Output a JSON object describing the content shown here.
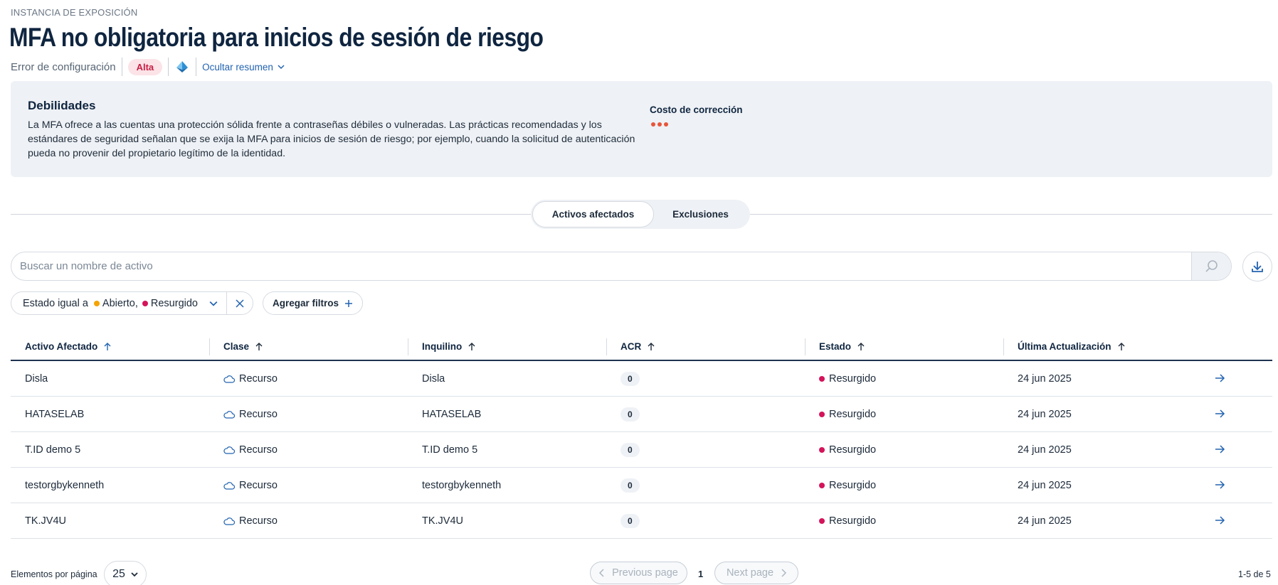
{
  "header": {
    "eyebrow": "INSTANCIA DE EXPOSICIÓN",
    "title": "MFA no obligatoria para inicios de sesión de riesgo",
    "category": "Error de configuración",
    "severity": "Alta",
    "platform_icon": "azure-icon",
    "summary_toggle": "Ocultar resumen"
  },
  "weakness": {
    "title": "Debilidades",
    "text": "La MFA ofrece a las cuentas una protección sólida frente a contraseñas débiles o vulneradas. Las prácticas recomendadas y los estándares de seguridad señalan que se exija la MFA para inicios de sesión de riesgo; por ejemplo, cuando la solicitud de autenticación pueda no provenir del propietario legítimo de la identidad.",
    "cost_label": "Costo de corrección",
    "cost_dots": 3
  },
  "tabs": [
    {
      "label": "Activos afectados",
      "active": true
    },
    {
      "label": "Exclusiones",
      "active": false
    }
  ],
  "search": {
    "placeholder": "Buscar un nombre de activo",
    "value": ""
  },
  "filter": {
    "prefix": "Estado igual a",
    "values": [
      {
        "label": "Abierto,",
        "color": "#f5a300"
      },
      {
        "label": "Resurgido",
        "color": "#d4145a"
      }
    ],
    "add_label": "Agregar filtros"
  },
  "table": {
    "columns": [
      "Activo Afectado",
      "Clase",
      "Inquilino",
      "ACR",
      "Estado",
      "Última Actualización"
    ],
    "rows": [
      {
        "asset": "Disla",
        "class": "Recurso",
        "tenant": "Disla",
        "acr": "0",
        "status": "Resurgido",
        "updated": "24 jun 2025"
      },
      {
        "asset": "HATASELAB",
        "class": "Recurso",
        "tenant": "HATASELAB",
        "acr": "0",
        "status": "Resurgido",
        "updated": "24 jun 2025"
      },
      {
        "asset": "T.ID demo 5",
        "class": "Recurso",
        "tenant": "T.ID demo 5",
        "acr": "0",
        "status": "Resurgido",
        "updated": "24 jun 2025"
      },
      {
        "asset": "testorgbykenneth",
        "class": "Recurso",
        "tenant": "testorgbykenneth",
        "acr": "0",
        "status": "Resurgido",
        "updated": "24 jun 2025"
      },
      {
        "asset": "TK.JV4U",
        "class": "Recurso",
        "tenant": "TK.JV4U",
        "acr": "0",
        "status": "Resurgido",
        "updated": "24 jun 2025"
      }
    ]
  },
  "pagination": {
    "per_page_label": "Elementos por página",
    "per_page_value": "25",
    "previous": "Previous page",
    "current": "1",
    "next": "Next page",
    "range": "1-5 de 5"
  },
  "colors": {
    "accent": "#2263b0",
    "severity_high": "#c81e45",
    "status_resurged": "#d4145a",
    "status_open": "#f5a300",
    "cost_dot": "#e8553a"
  }
}
